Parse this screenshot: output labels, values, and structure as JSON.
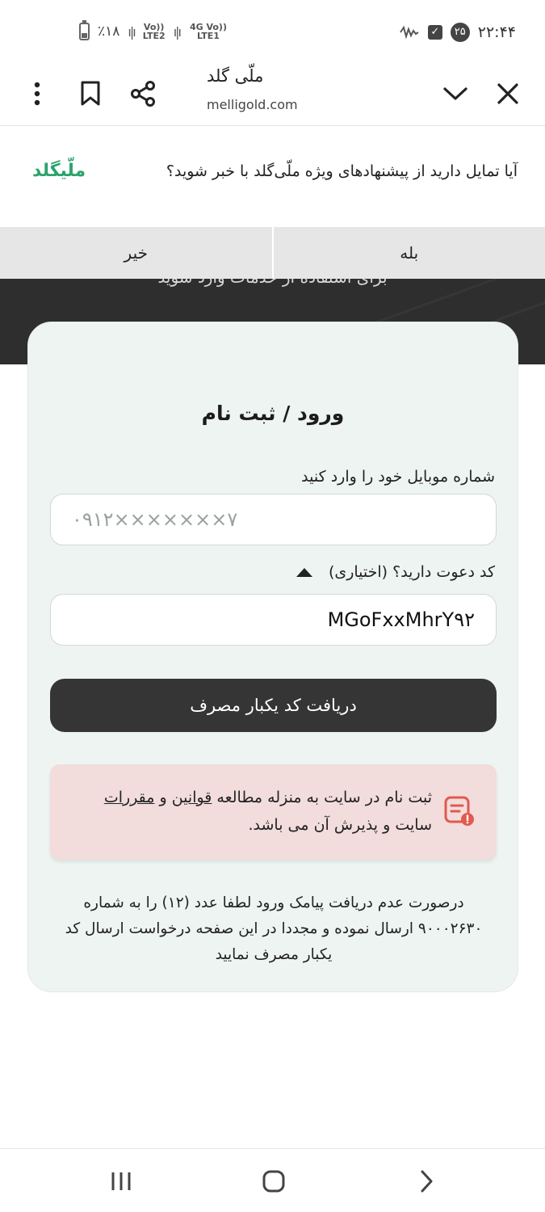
{
  "status_bar": {
    "battery": "٪۱۸",
    "sim1": "Vo)) LTE2",
    "sim2": "4G Vo)) LTE1",
    "time": "۲۲:۴۴",
    "notif_count": "۲۵"
  },
  "browser": {
    "title": "ملّی گلد",
    "url": "melligold.com"
  },
  "prompt": {
    "question": "آیا تمایل دارید از پیشنهادهای ویژه ملّی‌گلد با خبر شوید؟",
    "logo": "ملّیگلد",
    "yes": "بله",
    "no": "خیر"
  },
  "hero": {
    "text": "برای استفاده از خدمات وارد شوید"
  },
  "form": {
    "title": "ورود / ثبت نام",
    "phone_label": "شماره موبایل خود را وارد کنید",
    "phone_placeholder": "۰۹۱۲×××××××۷",
    "invite_label": "کد دعوت دارید؟ (اختیاری)",
    "invite_value": "MGoFxxMhrY۹۲",
    "submit": "دریافت کد یکبار مصرف"
  },
  "notice": {
    "before": "ثبت نام در سایت به منزله مطالعه ",
    "link1": "قوانین",
    "mid": " و ",
    "link2": "مقررات",
    "after": " سایت و پذیرش آن می باشد."
  },
  "help_text": "درصورت عدم دریافت پیامک ورود لطفا عدد (۱۲) را به شماره ۹۰۰۰۲۶۳۰ ارسال نموده و مجددا در این صفحه درخواست ارسال کد یکبار مصرف نمایید",
  "colors": {
    "accent": "#2ba36b",
    "dark": "#353535",
    "card_bg": "#eef4f2",
    "notice_bg": "#f2dcdc"
  }
}
